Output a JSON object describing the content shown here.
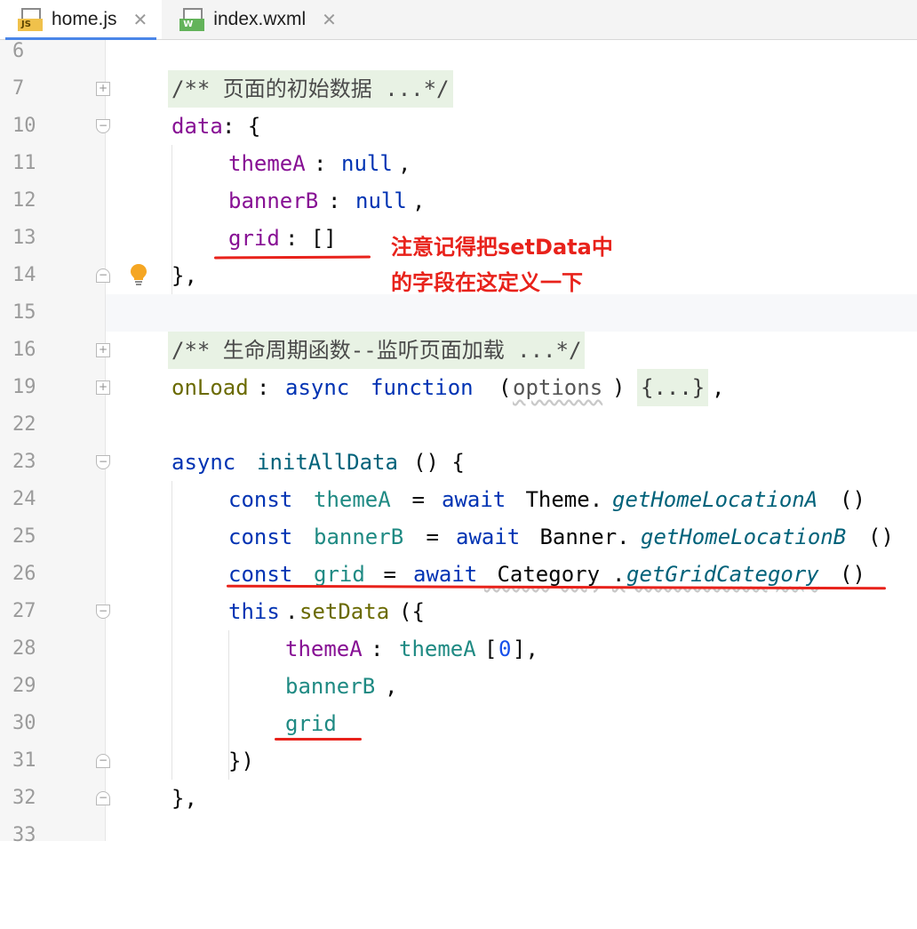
{
  "tabs": [
    {
      "label": "home.js",
      "icon": "js-file-icon",
      "badge": "JS",
      "active": true
    },
    {
      "label": "index.wxml",
      "icon": "wxml-file-icon",
      "badge": "W",
      "active": false
    }
  ],
  "close_glyph": "✕",
  "gutter": {
    "line_numbers": [
      "6",
      "7",
      "10",
      "11",
      "12",
      "13",
      "14",
      "15",
      "16",
      "19",
      "22",
      "23",
      "24",
      "25",
      "26",
      "27",
      "28",
      "29",
      "30",
      "31",
      "32",
      "33"
    ]
  },
  "code": {
    "l7_comment": "/** 页面的初始数据 ...*/",
    "l10_data": "data",
    "l10_rest": ": {",
    "l11_prop": "themeA",
    "l11_rest": ": ",
    "l11_null": "null",
    "l11_comma": ",",
    "l12_prop": "bannerB",
    "l12_rest": ": ",
    "l12_null": "null",
    "l12_comma": ",",
    "l13_prop": "grid",
    "l13_rest": ": []",
    "l14_close": "},",
    "l16_comment": "/** 生命周期函数--监听页面加载 ...*/",
    "l19_onload": "onLoad",
    "l19_colon": ": ",
    "l19_async": "async",
    "l19_function": "function",
    "l19_paren_open": "(",
    "l19_options": "options",
    "l19_paren_close": ") ",
    "l19_folded": "{...}",
    "l19_comma": ",",
    "l23_async": "async",
    "l23_name": "initAllData",
    "l23_rest": "() {",
    "l24_const": "const",
    "l24_var": "themeA",
    "l24_eq": " = ",
    "l24_await": "await",
    "l24_obj": " Theme.",
    "l24_method": "getHomeLocationA",
    "l24_call": "()",
    "l25_const": "const",
    "l25_var": "bannerB",
    "l25_eq": " = ",
    "l25_await": "await",
    "l25_obj": " Banner.",
    "l25_method": "getHomeLocationB",
    "l25_call": "()",
    "l26_const": "const",
    "l26_var": "grid",
    "l26_eq": " = ",
    "l26_await": "await",
    "l26_obj": " Category",
    "l26_dot": ".",
    "l26_method": "getGridCategory",
    "l26_call": "()",
    "l27_this": "this",
    "l27_dot": ".",
    "l27_method": "setData",
    "l27_rest": "({",
    "l28_prop": "themeA",
    "l28_colon": ": ",
    "l28_var": "themeA",
    "l28_open": "[",
    "l28_num": "0",
    "l28_close": "],",
    "l29_var": "bannerB",
    "l29_comma": ",",
    "l30_var": "grid",
    "l31_close": "})",
    "l32_close": "},"
  },
  "annotation": {
    "line1": "注意记得把setData中",
    "line2": "的字段在这定义一下",
    "color": "#e8221b"
  },
  "colors": {
    "keyword": "#0033b3",
    "property": "#871094",
    "function": "#00627a",
    "number": "#1750eb",
    "comment_bg": "#e8f2e4",
    "annotation_red": "#e8221b"
  }
}
